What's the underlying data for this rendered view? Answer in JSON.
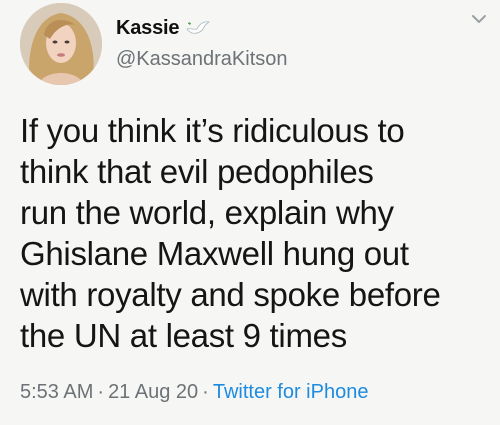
{
  "author": {
    "display_name": "Kassie",
    "handle": "@KassandraKitson",
    "avatar": "avatar-photo",
    "badge_icon": "dove-icon"
  },
  "tweet": {
    "lines": [
      "If you think it’s ridiculous to",
      "think that evil pedophiles",
      "run the world, explain why",
      "Ghislane Maxwell hung out",
      "with royalty and spoke before",
      "the UN at least 9 times"
    ]
  },
  "meta": {
    "time": "5:53 AM",
    "separator": "·",
    "date": "21 Aug 20",
    "source": "Twitter for iPhone"
  },
  "colors": {
    "background": "#f6f6f4",
    "text": "#151515",
    "muted": "#6c7276",
    "link": "#1d8ce0"
  }
}
